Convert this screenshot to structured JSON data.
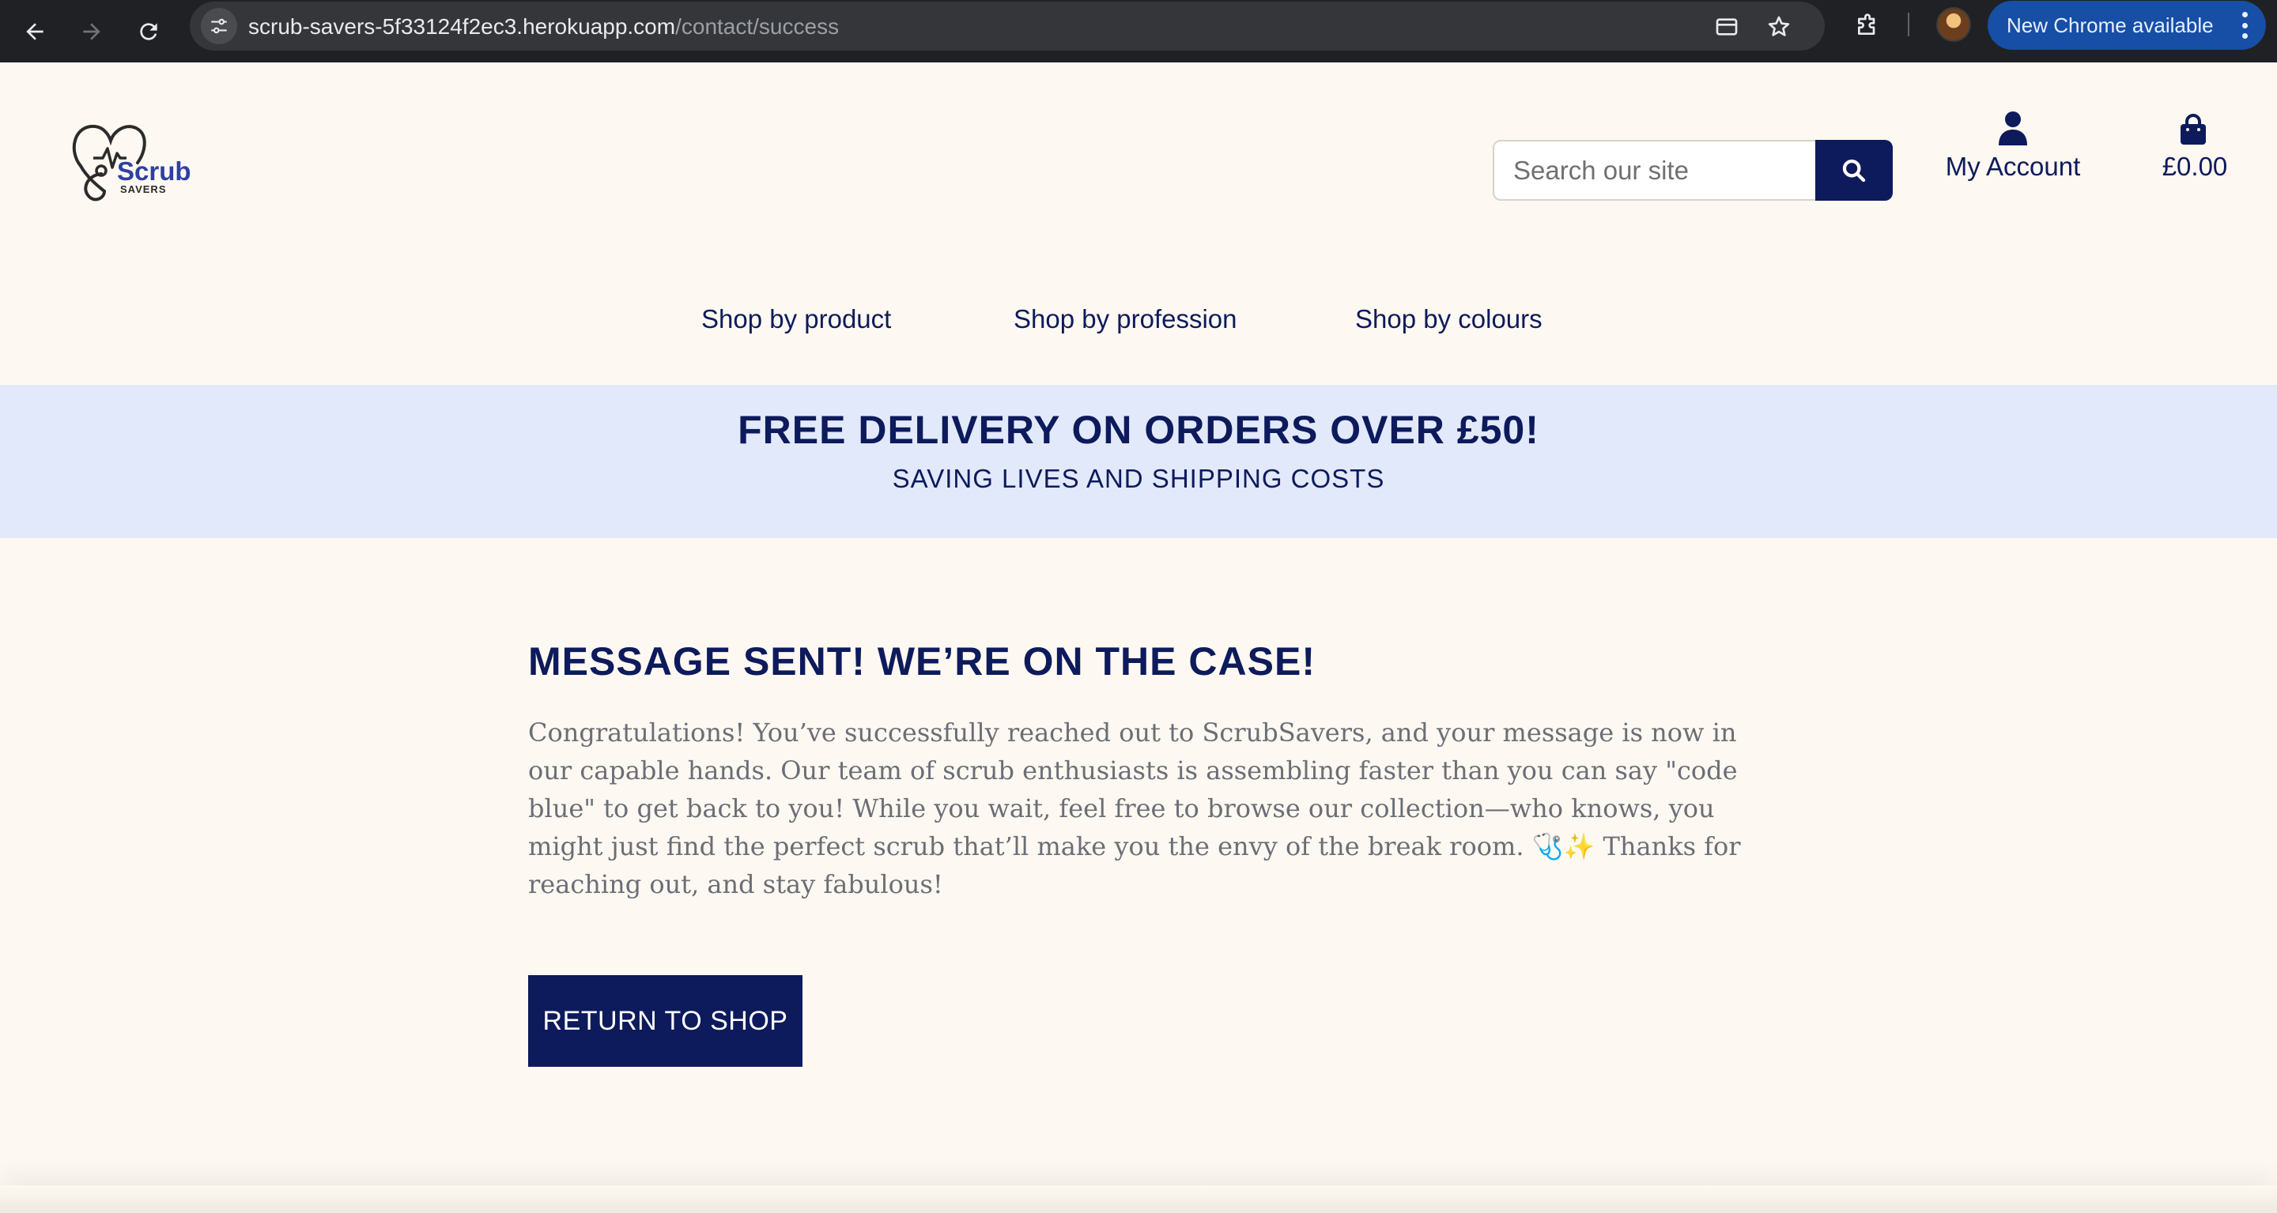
{
  "browser": {
    "url_domain": "scrub-savers-5f33124f2ec3.herokuapp.com",
    "url_path": "/contact/success",
    "update_label": "New Chrome available"
  },
  "header": {
    "logo_text": "Scrub",
    "logo_subtext": "SAVERS",
    "search_placeholder": "Search our site",
    "account_label": "My Account",
    "cart_total": "£0.00"
  },
  "nav": {
    "items": [
      {
        "label": "Shop by product"
      },
      {
        "label": "Shop by profession"
      },
      {
        "label": "Shop by colours"
      }
    ]
  },
  "banner": {
    "headline": "FREE DELIVERY ON ORDERS OVER £50!",
    "subline": "SAVING LIVES AND SHIPPING COSTS"
  },
  "main": {
    "title": "MESSAGE SENT! WE’RE ON THE CASE!",
    "body": "Congratulations! You’ve successfully reached out to ScrubSavers, and your message is now in our capable hands. Our team of scrub enthusiasts is assembling faster than you can say \"code blue\" to get back to you! While you wait, feel free to browse our collection—who knows, you might just find the perfect scrub that’ll make you the envy of the break room. 🩺✨ Thanks for reaching out, and stay fabulous!",
    "button_label": "RETURN TO SHOP"
  },
  "colors": {
    "brand_navy": "#0d1b5c",
    "page_bg": "#fdf8f1",
    "banner_bg": "#e2e9fa",
    "logo_blue": "#2f3fa3"
  }
}
